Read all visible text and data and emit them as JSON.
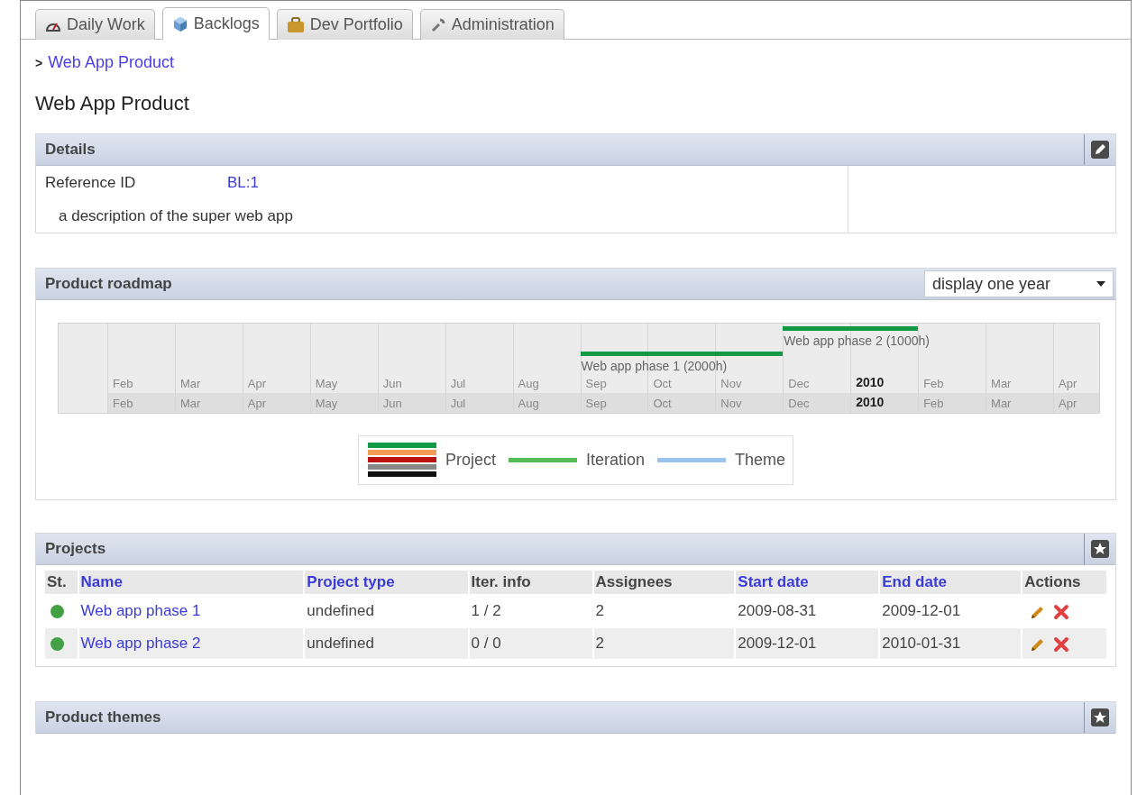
{
  "tabs": [
    {
      "label": "Daily Work",
      "selected": false
    },
    {
      "label": "Backlogs",
      "selected": true
    },
    {
      "label": "Dev Portfolio",
      "selected": false
    },
    {
      "label": "Administration",
      "selected": false
    }
  ],
  "breadcrumb": {
    "separator": ">",
    "link": "Web App Product"
  },
  "page_title": "Web App Product",
  "details": {
    "title": "Details",
    "fields": [
      {
        "label": "Reference ID",
        "value": "BL:1"
      }
    ],
    "description": "a description of the super web app"
  },
  "roadmap": {
    "title": "Product roadmap",
    "range_select": "display one year",
    "months_upper": [
      "Feb",
      "Mar",
      "Apr",
      "May",
      "Jun",
      "Jul",
      "Aug",
      "Sep",
      "Oct",
      "Nov",
      "Dec",
      "2010",
      "Feb",
      "Mar",
      "Apr"
    ],
    "months_lower": [
      "Feb",
      "Mar",
      "Apr",
      "May",
      "Jun",
      "Jul",
      "Aug",
      "Sep",
      "Oct",
      "Nov",
      "Dec",
      "2010",
      "Feb",
      "Mar",
      "Apr"
    ],
    "bars": [
      {
        "label": "Web app phase 1 (2000h)"
      },
      {
        "label": "Web app phase 2 (1000h)"
      }
    ],
    "legend": [
      {
        "label": "Project",
        "kind": "project"
      },
      {
        "label": "Iteration",
        "kind": "iteration"
      },
      {
        "label": "Theme",
        "kind": "theme"
      }
    ]
  },
  "projects": {
    "title": "Projects",
    "columns": [
      {
        "label": "St.",
        "sortable": false
      },
      {
        "label": "Name",
        "sortable": true
      },
      {
        "label": "Project type",
        "sortable": true
      },
      {
        "label": "Iter. info",
        "sortable": false
      },
      {
        "label": "Assignees",
        "sortable": false
      },
      {
        "label": "Start date",
        "sortable": true
      },
      {
        "label": "End date",
        "sortable": true
      },
      {
        "label": "Actions",
        "sortable": false
      }
    ],
    "rows": [
      {
        "on_track": true,
        "name": "Web app phase 1",
        "type": "undefined",
        "iter_info": "1 / 2",
        "assignees": "2",
        "start": "2009-08-31",
        "end": "2009-12-01"
      },
      {
        "on_track": true,
        "name": "Web app phase 2",
        "type": "undefined",
        "iter_info": "0 / 0",
        "assignees": "2",
        "start": "2009-12-01",
        "end": "2010-01-31"
      }
    ]
  },
  "themes": {
    "title": "Product themes"
  }
}
